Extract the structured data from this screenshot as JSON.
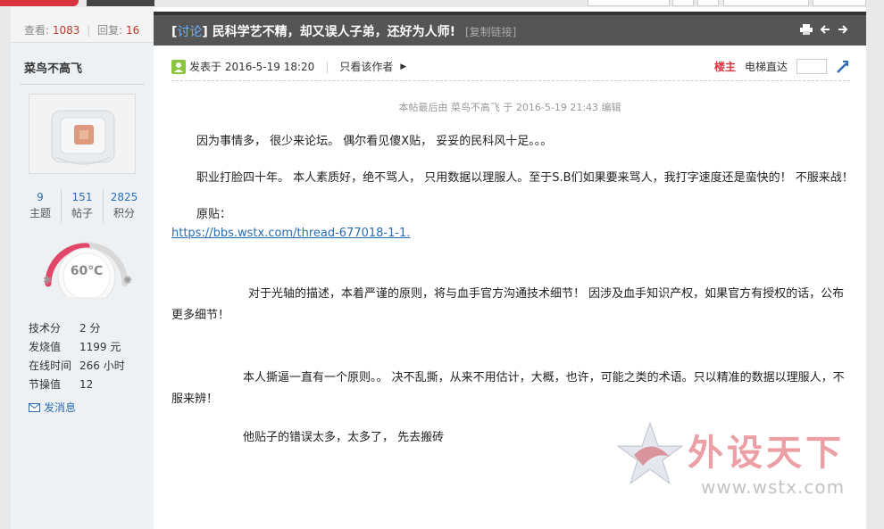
{
  "author_panel": {
    "views_label": "查看:",
    "views": "1083",
    "replies_label": "回复:",
    "replies": "16",
    "name": "菜鸟不高飞",
    "counts": [
      {
        "value": "9",
        "label": "主题"
      },
      {
        "value": "151",
        "label": "帖子"
      },
      {
        "value": "2825",
        "label": "积分"
      }
    ],
    "gauge_text": "60℃",
    "info": [
      {
        "key": "技术分",
        "value": "2 分"
      },
      {
        "key": "发烧值",
        "value": "1199 元"
      },
      {
        "key": "在线时间",
        "value": "266 小时"
      },
      {
        "key": "节操值",
        "value": "12"
      }
    ],
    "message_label": "发消息"
  },
  "post": {
    "category_open": "[",
    "category": "讨论",
    "category_close": "]",
    "title": "民科学艺不精，却又误人子弟，还好为人师!",
    "copy_link": "[复制链接]",
    "posted_at": "发表于 2016-5-19 18:20",
    "only_author": "只看该作者",
    "floor_label": "楼主",
    "elevator_label": "电梯直达",
    "edited_note": "本帖最后由 菜鸟不高飞 于 2016-5-19 21:43 编辑",
    "paragraphs": [
      "因为事情多， 很少来论坛。 偶尔看见傻X贴， 妥妥的民科风十足。。。",
      "职业打脸四十年。 本人素质好，绝不骂人， 只用数据以理服人。至于S.B们如果要来骂人，我打字速度还是蛮快的！ 不服来战！",
      "原贴：",
      "https://bbs.wstx.com/thread-677018-1-1.",
      "对于光轴的描述，本着严谨的原则，将与血手官方沟通技术细节！  因涉及血手知识产权，如果官方有授权的话，公布更多细节！",
      "本人撕逼一直有一个原则。。 决不乱撕，从来不用估计，大概，也许，可能之类的术语。只以精准的数据以理服人，不服来辨！",
      "他贴子的错误太多，太多了，  先去搬砖"
    ]
  },
  "watermark": {
    "text": "外设天下",
    "url": "www.wstx.com"
  },
  "colors": {
    "title_bar": "#555555",
    "accent_red": "#d9333f",
    "link_blue": "#2b6cb0"
  }
}
